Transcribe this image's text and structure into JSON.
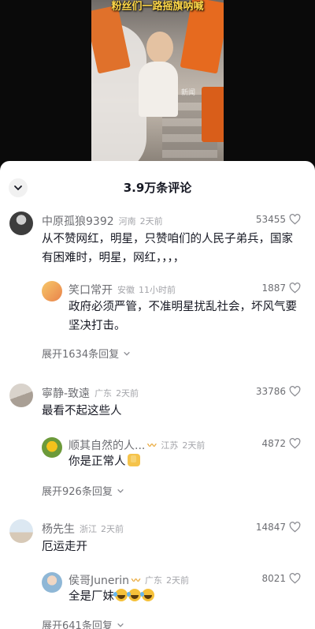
{
  "video": {
    "caption": "粉丝们一路摇旗呐喊",
    "watermark": "新闻"
  },
  "sheet": {
    "title": "3.9万条评论"
  },
  "threads": [
    {
      "user": "中原孤狼9392",
      "location": "河南",
      "time": "2天前",
      "likes": "53455",
      "text": [
        "从不赞网红，明星，只赞咱们的人民子弟兵，国家",
        "有困难时，明星，网红，，，，"
      ],
      "reply": {
        "user": "笑口常开",
        "location": "安徽",
        "time": "11小时前",
        "likes": "1887",
        "text": [
          "政府必须严管，不准明星扰乱社会，坏风气要",
          "坚决打击。"
        ]
      },
      "expand": "展开1634条回复"
    },
    {
      "user": "寧静-致遠",
      "location": "广东",
      "time": "2天前",
      "likes": "33786",
      "text": [
        "最看不起这些人"
      ],
      "reply": {
        "user": "顺其自然的人...",
        "location": "江苏",
        "time": "2天前",
        "likes": "4872",
        "text": [
          "你是正常人"
        ]
      },
      "expand": "展开926条回复"
    },
    {
      "user": "杨先生",
      "location": "浙江",
      "time": "2天前",
      "likes": "14847",
      "text": [
        "厄运走开"
      ],
      "reply": {
        "user": "侯哥Junerin",
        "location": "广东",
        "time": "2天前",
        "likes": "8021",
        "text": [
          "全是厂妹"
        ]
      },
      "expand": "展开641条回复"
    }
  ]
}
